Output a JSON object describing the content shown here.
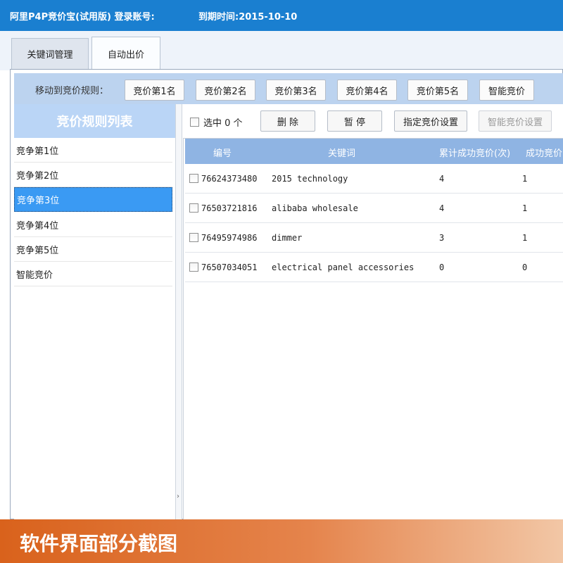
{
  "titlebar": {
    "app_and_login": "阿里P4P竞价宝(试用版) 登录账号:",
    "expiry": "到期时间:2015-10-10"
  },
  "tabs": [
    {
      "label": "关键词管理"
    },
    {
      "label": "自动出价",
      "active": true
    }
  ],
  "rule_bar": {
    "label": "移动到竞价规则：",
    "buttons": [
      "竞价第1名",
      "竞价第2名",
      "竞价第3名",
      "竞价第4名",
      "竞价第5名",
      "智能竞价"
    ]
  },
  "rule_list": {
    "title": "竞价规则列表",
    "items": [
      "竞争第1位",
      "竞争第2位",
      "竞争第3位",
      "竞争第4位",
      "竞争第5位",
      "智能竞价"
    ],
    "selected_index": 2
  },
  "toolbar": {
    "select_label": "选中 0 个",
    "delete_label": "删  除",
    "pause_label": "暂  停",
    "set_bid_label": "指定竞价设置",
    "smart_bid_label": "智能竞价设置"
  },
  "table": {
    "columns": [
      "编号",
      "关键词",
      "累计成功竞价(次)",
      "成功竞价"
    ],
    "rows": [
      {
        "id": "76624373480",
        "keyword": "2015 technology",
        "total": "4",
        "success": "1"
      },
      {
        "id": "76503721816",
        "keyword": "alibaba wholesale",
        "total": "4",
        "success": "1"
      },
      {
        "id": "76495974986",
        "keyword": "dimmer",
        "total": "3",
        "success": "1"
      },
      {
        "id": "76507034051",
        "keyword": "electrical panel accessories",
        "total": "0",
        "success": "0"
      }
    ]
  },
  "banner": {
    "text": "软件界面部分截图"
  },
  "colors": {
    "titlebar": "#1a7fd0",
    "rule_bar": "#bcd3ef",
    "list_header": "#bad5f6",
    "selected_item": "#3a9af3",
    "table_header": "#8fb4e3",
    "banner": "#d9621c"
  }
}
